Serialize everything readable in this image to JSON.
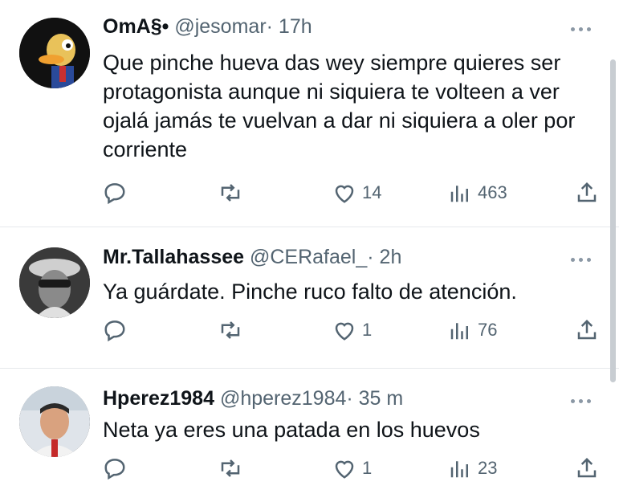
{
  "tweets": [
    {
      "name": "OmA§•",
      "handle": "@jesomar",
      "time": "· 17h",
      "text": "Que pinche hueva das wey siempre quieres ser protagonista aunque ni siquiera te volteen a ver ojalá jamás te vuelvan a dar ni siquiera a oler por corriente",
      "likes": "14",
      "views": "463"
    },
    {
      "name": "Mr.Tallahassee",
      "handle": "@CERafael_",
      "time": "· 2h",
      "text": "Ya guárdate. Pinche ruco falto de atención.",
      "likes": "1",
      "views": "76"
    },
    {
      "name": "Hperez1984",
      "handle": "@hperez1984",
      "time": "· 35 m",
      "text": "Neta ya eres una patada en los huevos",
      "likes": "1",
      "views": "23"
    }
  ],
  "icons": [
    "reply-icon",
    "retweet-icon",
    "like-icon",
    "views-icon",
    "share-icon",
    "more-icon"
  ],
  "colors": {
    "text": "#0f1419",
    "secondary": "#536471",
    "divider": "#e6e9ec"
  }
}
